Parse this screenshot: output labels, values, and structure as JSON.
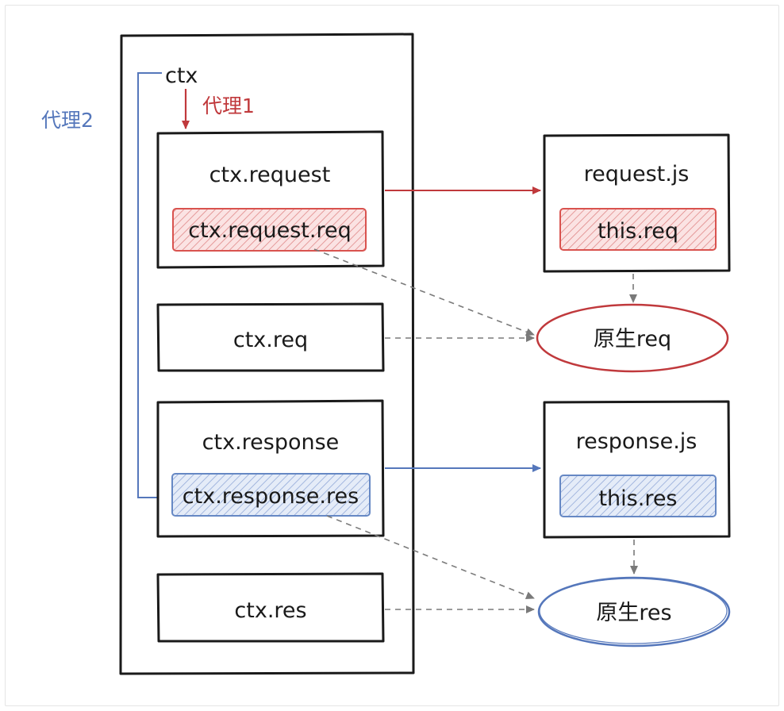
{
  "ctx_label": "ctx",
  "proxy1_label": "代理1",
  "proxy2_label": "代理2",
  "ctx_request": {
    "title": "ctx.request",
    "inner": "ctx.request.req"
  },
  "ctx_req": {
    "label": "ctx.req"
  },
  "ctx_response": {
    "title": "ctx.response",
    "inner": "ctx.response.res"
  },
  "ctx_res": {
    "label": "ctx.res"
  },
  "request_js": {
    "title": "request.js",
    "inner": "this.req"
  },
  "response_js": {
    "title": "response.js",
    "inner": "this.res"
  },
  "native_req": {
    "label": "原生req"
  },
  "native_res": {
    "label": "原生res"
  },
  "colors": {
    "red": "#c0393c",
    "blue": "#5577bb",
    "black": "#1a1a1a",
    "gray": "#888888"
  }
}
